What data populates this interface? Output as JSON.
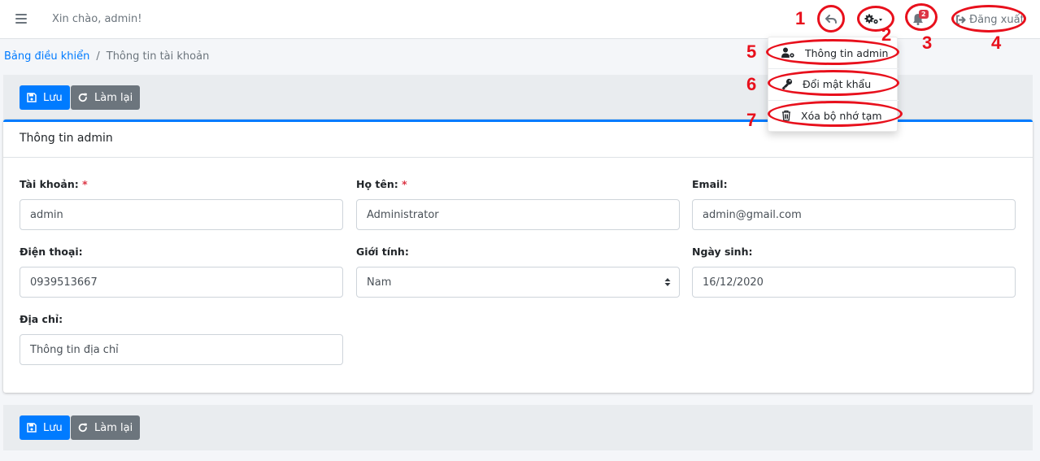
{
  "navbar": {
    "greeting": "Xin chào, admin!",
    "notification_count": "2",
    "logout_label": "Đăng xuất"
  },
  "dropdown": {
    "items": [
      {
        "label": "Thông tin admin",
        "icon": "user-cog-icon"
      },
      {
        "label": "Đổi mật khẩu",
        "icon": "key-icon"
      },
      {
        "label": "Xóa bộ nhớ tạm",
        "icon": "trash-icon"
      }
    ]
  },
  "breadcrumb": {
    "home": "Bảng điều khiển",
    "separator": "/",
    "current": "Thông tin tài khoản"
  },
  "toolbar": {
    "save_label": "Lưu",
    "reset_label": "Làm lại"
  },
  "card": {
    "title": "Thông tin admin",
    "required_mark": "*",
    "fields": {
      "account": {
        "label": "Tài khoản:",
        "value": "admin",
        "required": true
      },
      "fullname": {
        "label": "Họ tên:",
        "value": "Administrator",
        "required": true
      },
      "email": {
        "label": "Email:",
        "value": "admin@gmail.com"
      },
      "phone": {
        "label": "Điện thoại:",
        "value": "0939513667"
      },
      "gender": {
        "label": "Giới tính:",
        "value": "Nam"
      },
      "birthday": {
        "label": "Ngày sinh:",
        "value": "16/12/2020"
      },
      "address": {
        "label": "Địa chỉ:",
        "value": "Thông tin địa chỉ"
      }
    }
  },
  "annotations": [
    "1",
    "2",
    "3",
    "4",
    "5",
    "6",
    "7"
  ],
  "colors": {
    "primary": "#007bff",
    "secondary": "#6c757d",
    "danger": "#dc3545",
    "annotation_red": "#e8101c"
  }
}
